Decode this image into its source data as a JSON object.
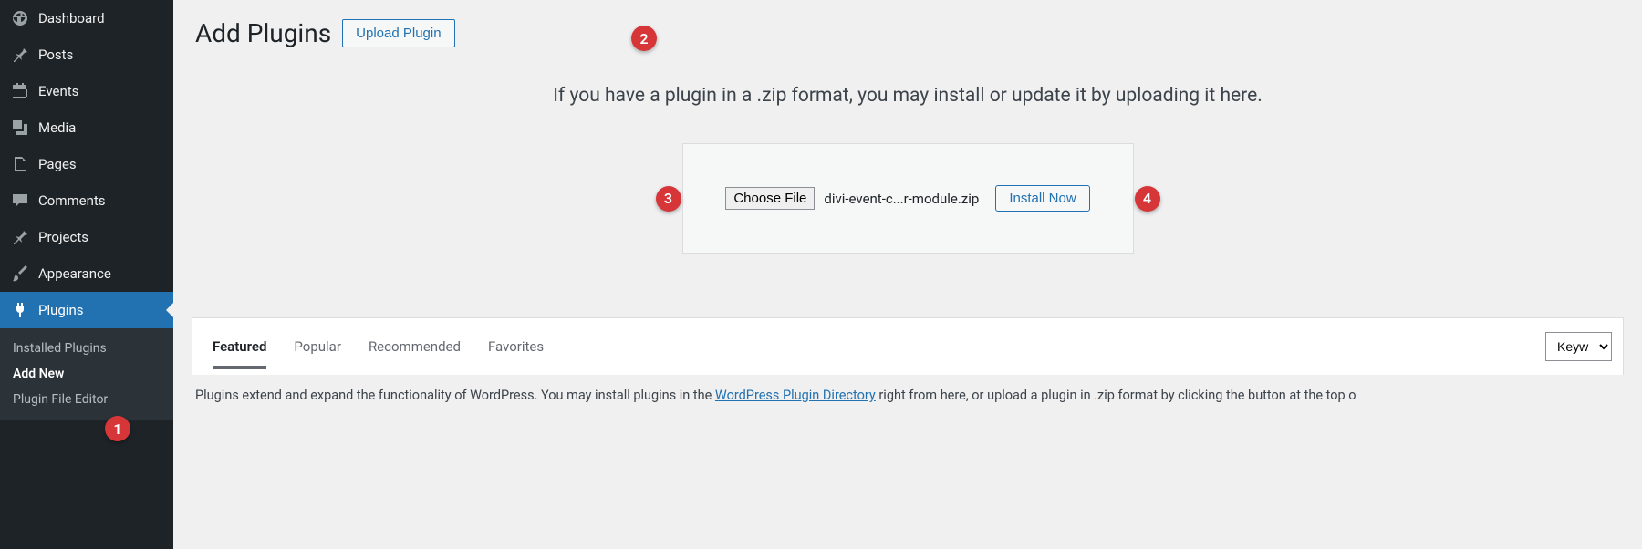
{
  "sidebar": {
    "items": [
      {
        "label": "Dashboard"
      },
      {
        "label": "Posts"
      },
      {
        "label": "Events"
      },
      {
        "label": "Media"
      },
      {
        "label": "Pages"
      },
      {
        "label": "Comments"
      },
      {
        "label": "Projects"
      },
      {
        "label": "Appearance"
      },
      {
        "label": "Plugins"
      }
    ],
    "submenu": [
      {
        "label": "Installed Plugins"
      },
      {
        "label": "Add New"
      },
      {
        "label": "Plugin File Editor"
      }
    ]
  },
  "page": {
    "title": "Add Plugins",
    "upload_btn": "Upload Plugin",
    "upload_hint": "If you have a plugin in a .zip format, you may install or update it by uploading it here.",
    "choose_file": "Choose File",
    "filename": "divi-event-c...r-module.zip",
    "install_now": "Install Now",
    "tabs": [
      {
        "label": "Featured"
      },
      {
        "label": "Popular"
      },
      {
        "label": "Recommended"
      },
      {
        "label": "Favorites"
      }
    ],
    "search_selector": "Keyw",
    "explanatory_prefix": "Plugins extend and expand the functionality of WordPress. You may install plugins in the ",
    "explanatory_link": "WordPress Plugin Directory",
    "explanatory_suffix": " right from here, or upload a plugin in .zip format by clicking the button at the top o"
  },
  "badges": {
    "b1": "1",
    "b2": "2",
    "b3": "3",
    "b4": "4"
  }
}
